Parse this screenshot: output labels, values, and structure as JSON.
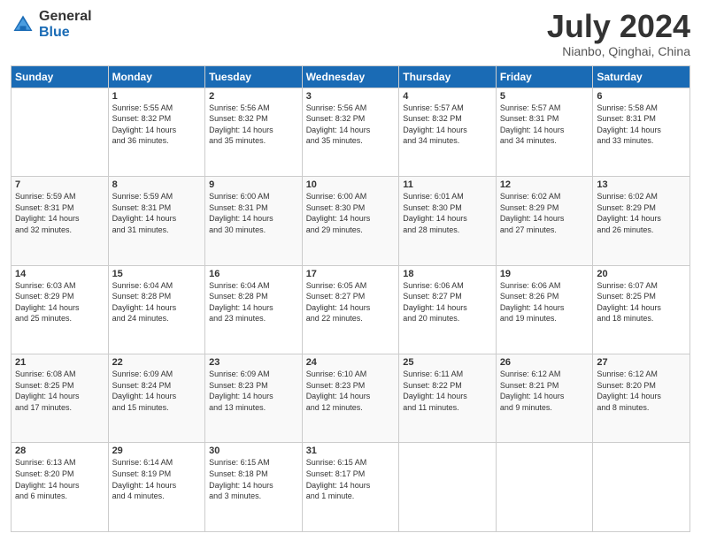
{
  "header": {
    "logo_general": "General",
    "logo_blue": "Blue",
    "month_title": "July 2024",
    "location": "Nianbo, Qinghai, China"
  },
  "days_of_week": [
    "Sunday",
    "Monday",
    "Tuesday",
    "Wednesday",
    "Thursday",
    "Friday",
    "Saturday"
  ],
  "weeks": [
    [
      {
        "day": "",
        "info": ""
      },
      {
        "day": "1",
        "info": "Sunrise: 5:55 AM\nSunset: 8:32 PM\nDaylight: 14 hours\nand 36 minutes."
      },
      {
        "day": "2",
        "info": "Sunrise: 5:56 AM\nSunset: 8:32 PM\nDaylight: 14 hours\nand 35 minutes."
      },
      {
        "day": "3",
        "info": "Sunrise: 5:56 AM\nSunset: 8:32 PM\nDaylight: 14 hours\nand 35 minutes."
      },
      {
        "day": "4",
        "info": "Sunrise: 5:57 AM\nSunset: 8:32 PM\nDaylight: 14 hours\nand 34 minutes."
      },
      {
        "day": "5",
        "info": "Sunrise: 5:57 AM\nSunset: 8:31 PM\nDaylight: 14 hours\nand 34 minutes."
      },
      {
        "day": "6",
        "info": "Sunrise: 5:58 AM\nSunset: 8:31 PM\nDaylight: 14 hours\nand 33 minutes."
      }
    ],
    [
      {
        "day": "7",
        "info": "Sunrise: 5:59 AM\nSunset: 8:31 PM\nDaylight: 14 hours\nand 32 minutes."
      },
      {
        "day": "8",
        "info": "Sunrise: 5:59 AM\nSunset: 8:31 PM\nDaylight: 14 hours\nand 31 minutes."
      },
      {
        "day": "9",
        "info": "Sunrise: 6:00 AM\nSunset: 8:31 PM\nDaylight: 14 hours\nand 30 minutes."
      },
      {
        "day": "10",
        "info": "Sunrise: 6:00 AM\nSunset: 8:30 PM\nDaylight: 14 hours\nand 29 minutes."
      },
      {
        "day": "11",
        "info": "Sunrise: 6:01 AM\nSunset: 8:30 PM\nDaylight: 14 hours\nand 28 minutes."
      },
      {
        "day": "12",
        "info": "Sunrise: 6:02 AM\nSunset: 8:29 PM\nDaylight: 14 hours\nand 27 minutes."
      },
      {
        "day": "13",
        "info": "Sunrise: 6:02 AM\nSunset: 8:29 PM\nDaylight: 14 hours\nand 26 minutes."
      }
    ],
    [
      {
        "day": "14",
        "info": "Sunrise: 6:03 AM\nSunset: 8:29 PM\nDaylight: 14 hours\nand 25 minutes."
      },
      {
        "day": "15",
        "info": "Sunrise: 6:04 AM\nSunset: 8:28 PM\nDaylight: 14 hours\nand 24 minutes."
      },
      {
        "day": "16",
        "info": "Sunrise: 6:04 AM\nSunset: 8:28 PM\nDaylight: 14 hours\nand 23 minutes."
      },
      {
        "day": "17",
        "info": "Sunrise: 6:05 AM\nSunset: 8:27 PM\nDaylight: 14 hours\nand 22 minutes."
      },
      {
        "day": "18",
        "info": "Sunrise: 6:06 AM\nSunset: 8:27 PM\nDaylight: 14 hours\nand 20 minutes."
      },
      {
        "day": "19",
        "info": "Sunrise: 6:06 AM\nSunset: 8:26 PM\nDaylight: 14 hours\nand 19 minutes."
      },
      {
        "day": "20",
        "info": "Sunrise: 6:07 AM\nSunset: 8:25 PM\nDaylight: 14 hours\nand 18 minutes."
      }
    ],
    [
      {
        "day": "21",
        "info": "Sunrise: 6:08 AM\nSunset: 8:25 PM\nDaylight: 14 hours\nand 17 minutes."
      },
      {
        "day": "22",
        "info": "Sunrise: 6:09 AM\nSunset: 8:24 PM\nDaylight: 14 hours\nand 15 minutes."
      },
      {
        "day": "23",
        "info": "Sunrise: 6:09 AM\nSunset: 8:23 PM\nDaylight: 14 hours\nand 13 minutes."
      },
      {
        "day": "24",
        "info": "Sunrise: 6:10 AM\nSunset: 8:23 PM\nDaylight: 14 hours\nand 12 minutes."
      },
      {
        "day": "25",
        "info": "Sunrise: 6:11 AM\nSunset: 8:22 PM\nDaylight: 14 hours\nand 11 minutes."
      },
      {
        "day": "26",
        "info": "Sunrise: 6:12 AM\nSunset: 8:21 PM\nDaylight: 14 hours\nand 9 minutes."
      },
      {
        "day": "27",
        "info": "Sunrise: 6:12 AM\nSunset: 8:20 PM\nDaylight: 14 hours\nand 8 minutes."
      }
    ],
    [
      {
        "day": "28",
        "info": "Sunrise: 6:13 AM\nSunset: 8:20 PM\nDaylight: 14 hours\nand 6 minutes."
      },
      {
        "day": "29",
        "info": "Sunrise: 6:14 AM\nSunset: 8:19 PM\nDaylight: 14 hours\nand 4 minutes."
      },
      {
        "day": "30",
        "info": "Sunrise: 6:15 AM\nSunset: 8:18 PM\nDaylight: 14 hours\nand 3 minutes."
      },
      {
        "day": "31",
        "info": "Sunrise: 6:15 AM\nSunset: 8:17 PM\nDaylight: 14 hours\nand 1 minute."
      },
      {
        "day": "",
        "info": ""
      },
      {
        "day": "",
        "info": ""
      },
      {
        "day": "",
        "info": ""
      }
    ]
  ]
}
